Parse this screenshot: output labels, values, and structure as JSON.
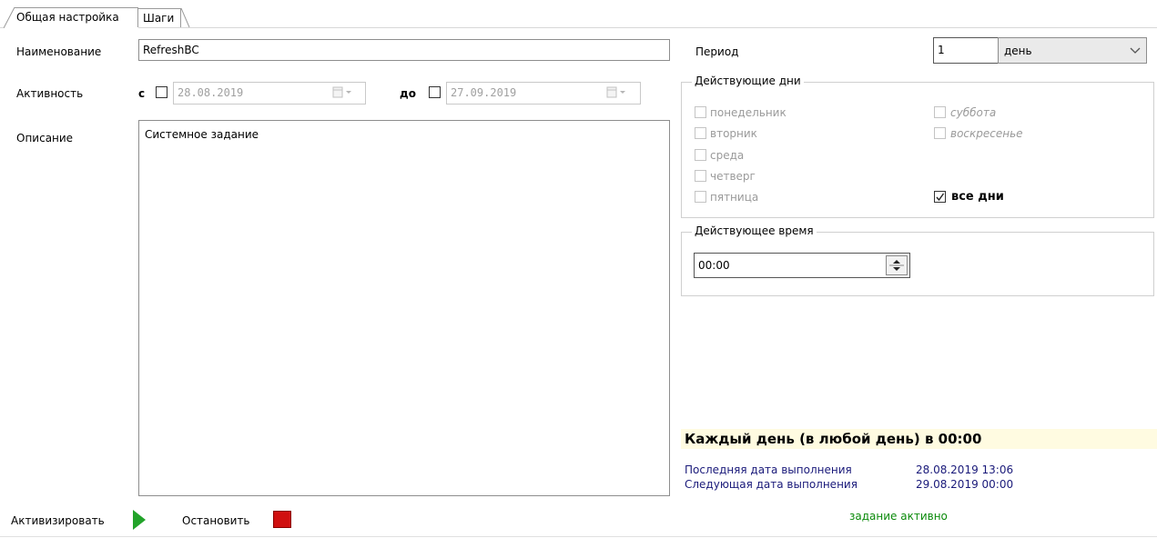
{
  "tabs": [
    {
      "label": "Общая настройка",
      "active": true
    },
    {
      "label": "Шаги",
      "active": false
    }
  ],
  "form": {
    "name_label": "Наименование",
    "name_value": "RefreshBC",
    "activity_label": "Активность",
    "from_label": "с",
    "from_date": "28.08.2019",
    "to_label": "до",
    "to_date": "27.09.2019",
    "description_label": "Описание",
    "description_value": "Системное задание"
  },
  "period": {
    "label": "Период",
    "value": "1",
    "unit": "день"
  },
  "active_days": {
    "legend": "Действующие дни",
    "days": [
      {
        "label": "понедельник",
        "checked": false
      },
      {
        "label": "вторник",
        "checked": false
      },
      {
        "label": "среда",
        "checked": false
      },
      {
        "label": "четверг",
        "checked": false
      },
      {
        "label": "пятница",
        "checked": false
      },
      {
        "label": "суббота",
        "checked": false
      },
      {
        "label": "воскресенье",
        "checked": false
      }
    ],
    "all_days_label": "все дни",
    "all_days_checked": true
  },
  "active_time": {
    "legend": "Действующее время",
    "value": "00:00"
  },
  "summary": {
    "schedule_text": "Каждый день (в любой день) в 00:00",
    "last_run_label": "Последняя дата выполнения",
    "last_run_value": "28.08.2019 13:06",
    "next_run_label": "Следующая дата выполнения",
    "next_run_value": "29.08.2019 00:00",
    "status": "задание активно"
  },
  "actions": {
    "activate_label": "Активизировать",
    "stop_label": "Остановить"
  },
  "colors": {
    "summary_bg": "#fffbe1",
    "run_info": "#1a1a7a",
    "status_green": "#0a8a0a",
    "play_green": "#22a32a",
    "stop_red": "#d01010"
  }
}
